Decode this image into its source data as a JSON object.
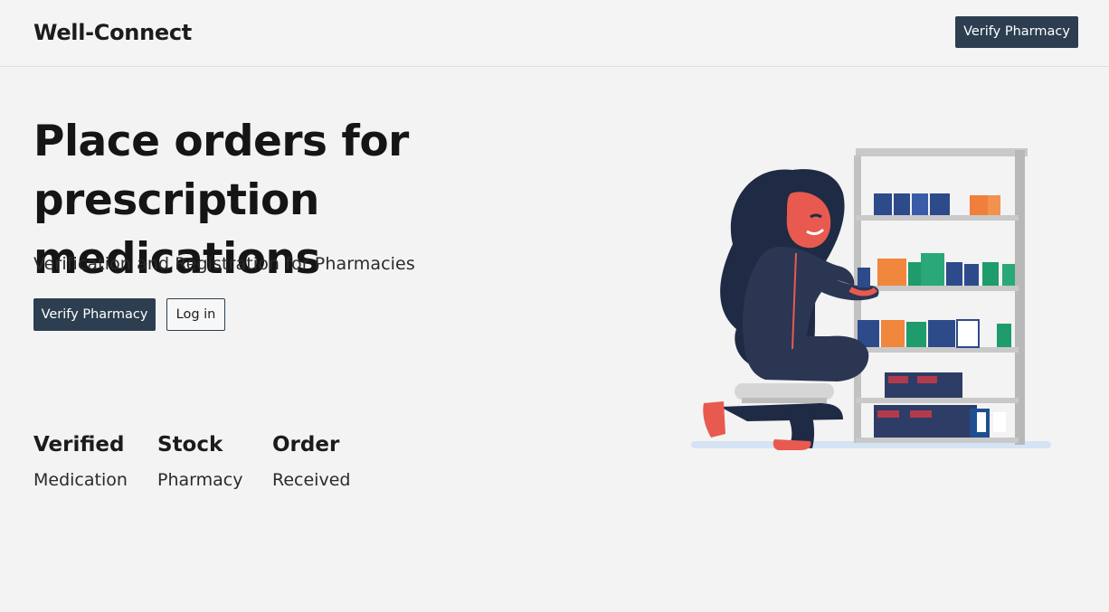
{
  "header": {
    "brand": "Well-Connect",
    "cta_label": "Verify Pharmacy"
  },
  "hero": {
    "title_line1": "Place orders for",
    "title_line2": "prescription medications",
    "subtitle": "Verification and Registration for Pharmacies",
    "primary_cta": "Verify Pharmacy",
    "secondary_cta": "Log in"
  },
  "stats": [
    {
      "title": "Verified",
      "subtitle": "Medication"
    },
    {
      "title": "Stock",
      "subtitle": "Pharmacy"
    },
    {
      "title": "Order",
      "subtitle": "Received"
    }
  ],
  "colors": {
    "primary": "#2c3e50",
    "background": "#f3f3f3"
  },
  "illustration": {
    "icon": "pharmacist-with-shelf-illustration"
  }
}
